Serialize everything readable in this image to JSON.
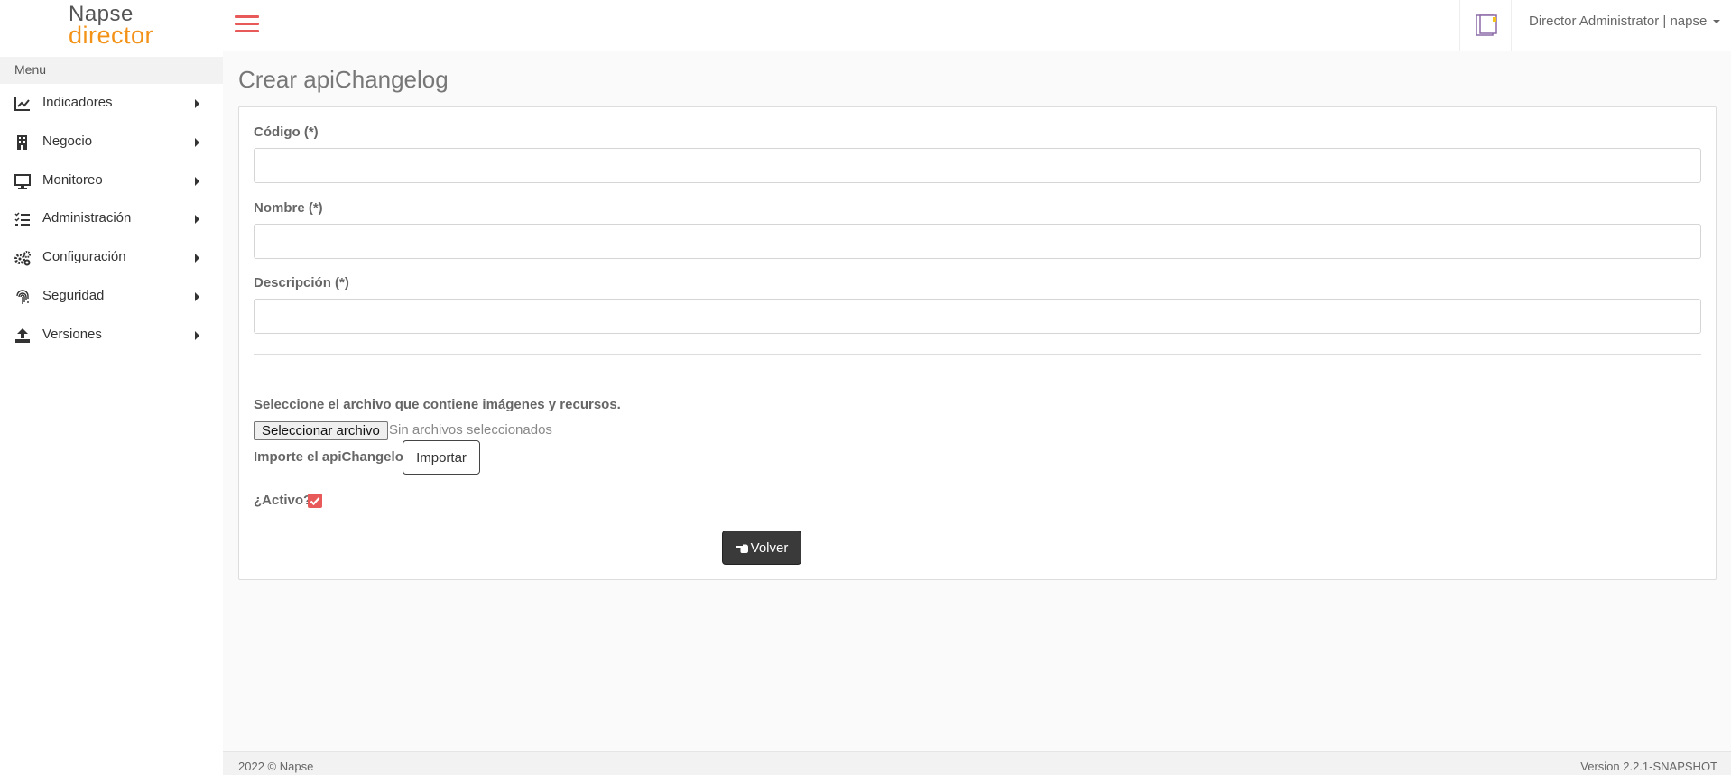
{
  "app": {
    "logo_line1": "Napse",
    "logo_line2": "director",
    "user": "Director Administrator | napse",
    "accent_color": "#e85a5a",
    "logo_accent_color": "#f39218"
  },
  "sidebar": {
    "header": "Menu",
    "items": [
      {
        "label": "Indicadores",
        "icon": "chart-line-icon"
      },
      {
        "label": "Negocio",
        "icon": "building-icon"
      },
      {
        "label": "Monitoreo",
        "icon": "desktop-icon"
      },
      {
        "label": "Administración",
        "icon": "tasks-list-icon"
      },
      {
        "label": "Configuración",
        "icon": "cogs-icon"
      },
      {
        "label": "Seguridad",
        "icon": "fingerprint-icon"
      },
      {
        "label": "Versiones",
        "icon": "upload-icon"
      }
    ]
  },
  "page": {
    "title": "Crear apiChangelog"
  },
  "form": {
    "codigo_label": "Código (*)",
    "codigo_value": "",
    "nombre_label": "Nombre (*)",
    "nombre_value": "",
    "descripcion_label": "Descripción (*)",
    "descripcion_value": "",
    "file_note": "Seleccione el archivo que contiene imágenes y recursos.",
    "file_button": "Seleccionar archivo",
    "file_none": "Sin archivos seleccionados",
    "import_label": "Importe el apiChangelog",
    "import_button": "Importar",
    "activo_label": "¿Activo?",
    "activo_checked": true,
    "volver_button": "Volver"
  },
  "footer": {
    "left": "2022 © Napse",
    "right": "Version 2.2.1-SNAPSHOT"
  }
}
